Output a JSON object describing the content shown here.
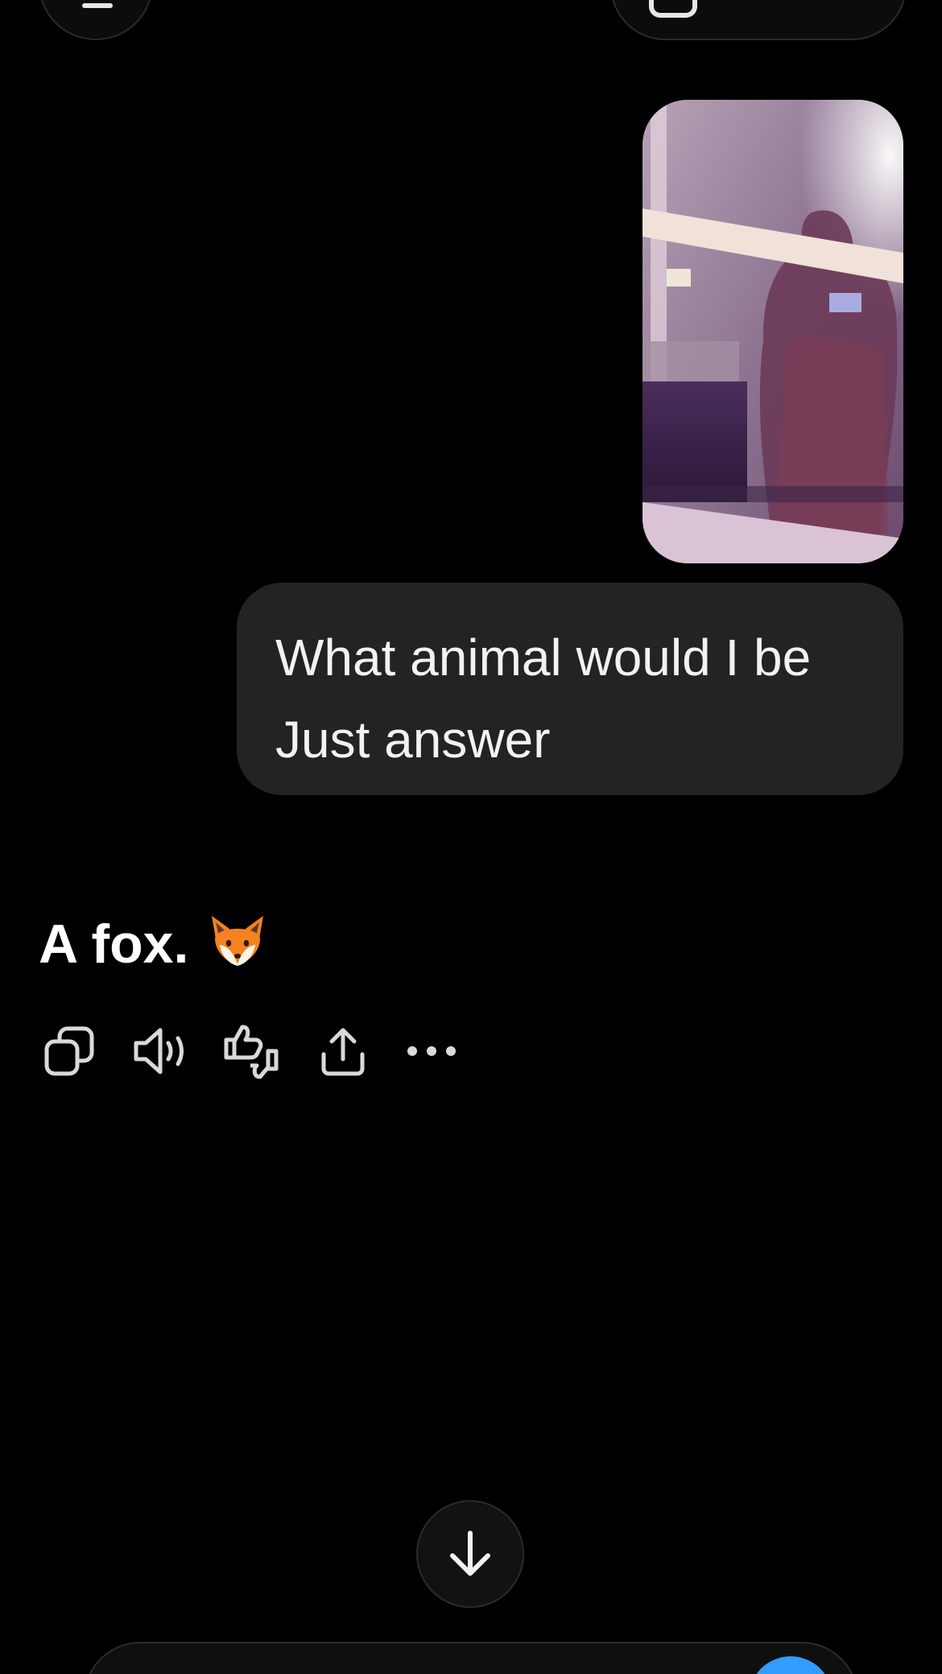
{
  "conversation": {
    "user_message": "What animal would I be\nJust answer",
    "assistant_message": {
      "text": "A fox.",
      "emoji": "fox-emoji"
    }
  },
  "icons": {
    "copy": "copy-icon",
    "read_aloud": "speaker-icon",
    "feedback": "thumbs-up-down-icon",
    "share": "share-icon",
    "more": "ellipsis-icon",
    "scroll_down": "arrow-down-icon"
  },
  "colors": {
    "background": "#000000",
    "bubble": "#232323",
    "send_button": "#339cff",
    "icon": "#d9d9d9"
  }
}
